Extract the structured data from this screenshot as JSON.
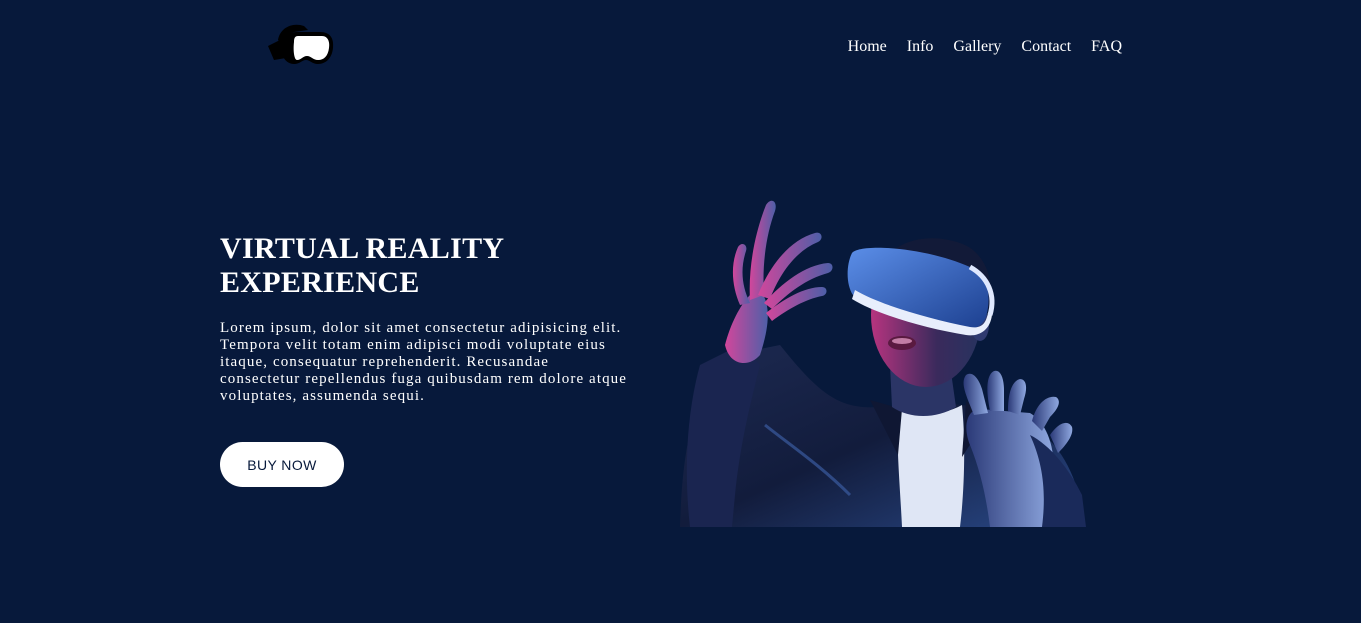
{
  "header": {
    "logo_icon": "vr-headset-icon",
    "nav": [
      {
        "label": "Home"
      },
      {
        "label": "Info"
      },
      {
        "label": "Gallery"
      },
      {
        "label": "Contact"
      },
      {
        "label": "FAQ"
      }
    ]
  },
  "hero": {
    "title_line1": "VIRTUAL REALITY",
    "title_line2": "EXPERIENCE",
    "text": "Lorem ipsum, dolor sit amet consectetur adipisicing elit. Tempora velit totam enim adipisci modi voluptate eius itaque, consequatur reprehenderit. Recusandae consectetur repellendus fuga quibusdam rem dolore atque voluptates, assumenda sequi.",
    "button_label": "BUY NOW",
    "image_icon": "vr-person-image"
  },
  "colors": {
    "background": "#07193b",
    "text": "#ffffff",
    "button_bg": "#ffffff",
    "button_text": "#07193b",
    "accent_pink": "#e0308f",
    "accent_blue": "#3d7be0"
  }
}
